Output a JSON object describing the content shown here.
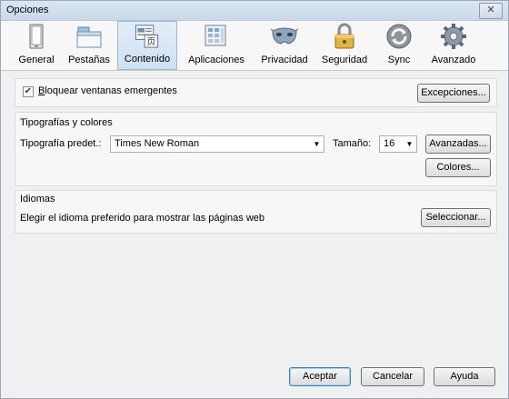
{
  "window": {
    "title": "Opciones",
    "close_glyph": "✕"
  },
  "toolbar": {
    "items": [
      {
        "label": "General",
        "icon": "general-icon"
      },
      {
        "label": "Pestañas",
        "icon": "tabs-icon"
      },
      {
        "label": "Contenido",
        "icon": "content-icon",
        "active": true
      },
      {
        "label": "Aplicaciones",
        "icon": "applications-icon"
      },
      {
        "label": "Privacidad",
        "icon": "privacy-mask-icon"
      },
      {
        "label": "Seguridad",
        "icon": "security-lock-icon"
      },
      {
        "label": "Sync",
        "icon": "sync-icon"
      },
      {
        "label": "Avanzado",
        "icon": "gear-icon"
      }
    ]
  },
  "popups": {
    "checkbox_label": "Bloquear ventanas emergentes",
    "checked": true,
    "exceptions_button": "Excepciones..."
  },
  "fonts": {
    "group_title": "Tipografías y colores",
    "default_font_label": "Tipografía predet.:",
    "default_font_value": "Times New Roman",
    "size_label": "Tamaño:",
    "size_value": "16",
    "advanced_button": "Avanzadas...",
    "colors_button": "Colores..."
  },
  "languages": {
    "group_title": "Idiomas",
    "description": "Elegir el idioma preferido para mostrar las páginas web",
    "choose_button": "Seleccionar..."
  },
  "footer": {
    "ok_button": "Aceptar",
    "cancel_button": "Cancelar",
    "help_button": "Ayuda"
  }
}
